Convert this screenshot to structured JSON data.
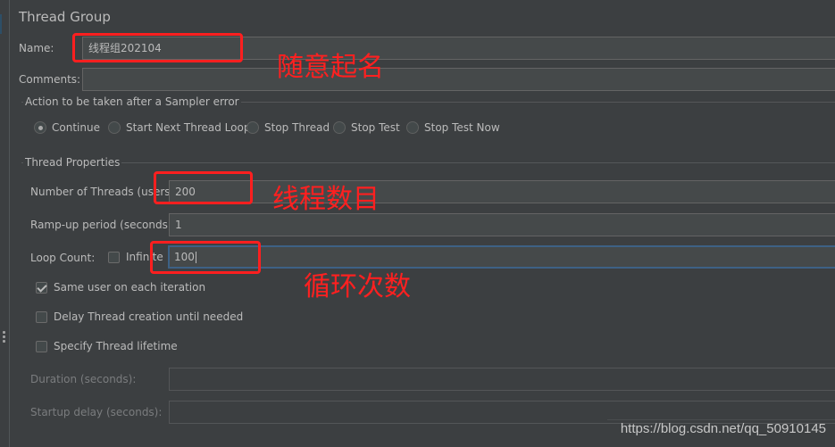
{
  "panel": {
    "title": "Thread Group",
    "name_label": "Name:",
    "name_value": "线程组202104",
    "comments_label": "Comments:",
    "comments_value": ""
  },
  "sampler_error": {
    "group_title": "Action to be taken after a Sampler error",
    "options": [
      {
        "label": "Continue",
        "selected": true
      },
      {
        "label": "Start Next Thread Loop",
        "selected": false
      },
      {
        "label": "Stop Thread",
        "selected": false
      },
      {
        "label": "Stop Test",
        "selected": false
      },
      {
        "label": "Stop Test Now",
        "selected": false
      }
    ]
  },
  "thread_properties": {
    "group_title": "Thread Properties",
    "num_threads_label": "Number of Threads (users):",
    "num_threads_value": "200",
    "rampup_label": "Ramp-up period (seconds):",
    "rampup_value": "1",
    "loop_count_label": "Loop Count:",
    "infinite_label": "Infinite",
    "infinite_checked": false,
    "loop_count_value": "100",
    "same_user_label": "Same user on each iteration",
    "same_user_checked": true,
    "delay_creation_label": "Delay Thread creation until needed",
    "delay_creation_checked": false,
    "specify_lifetime_label": "Specify Thread lifetime",
    "specify_lifetime_checked": false,
    "duration_label": "Duration (seconds):",
    "duration_value": "",
    "startup_delay_label": "Startup delay (seconds):",
    "startup_delay_value": ""
  },
  "annotations": {
    "name_note": "随意起名",
    "threads_note": "线程数目",
    "loop_note": "循环次数",
    "color": "#ff1f1f"
  },
  "watermark": "https://blog.csdn.net/qq_50910145"
}
